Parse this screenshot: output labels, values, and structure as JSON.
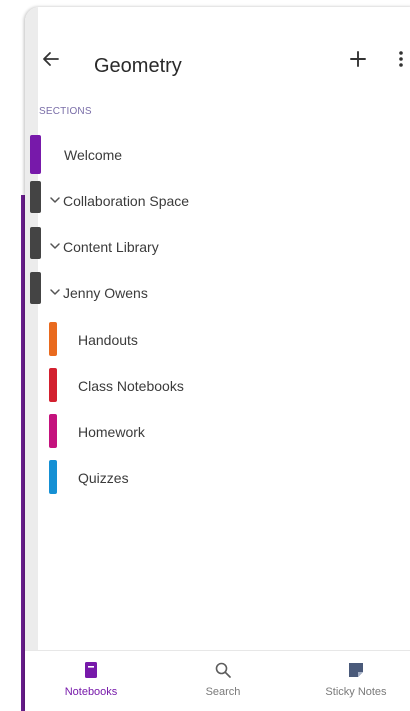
{
  "header": {
    "title": "Geometry",
    "icons": {
      "back": "arrow-left-icon",
      "add": "plus-icon",
      "more": "more-vertical-icon"
    }
  },
  "sections_label": "SECTIONS",
  "sections": [
    {
      "label": "Welcome",
      "type": "section",
      "color": "#7719aa"
    },
    {
      "label": "Collaboration Space",
      "type": "group",
      "color": "#444444"
    },
    {
      "label": "Content Library",
      "type": "group",
      "color": "#444444"
    },
    {
      "label": "Jenny Owens",
      "type": "group",
      "color": "#444444"
    },
    {
      "label": "Handouts",
      "type": "section",
      "color": "#e96a1e"
    },
    {
      "label": "Class Notebooks",
      "type": "section",
      "color": "#d3202f"
    },
    {
      "label": "Homework",
      "type": "section",
      "color": "#c4127d"
    },
    {
      "label": "Quizzes",
      "type": "section",
      "color": "#1590d4"
    }
  ],
  "bottom_nav": [
    {
      "label": "Notebooks",
      "icon": "notebook-icon",
      "active": true
    },
    {
      "label": "Search",
      "icon": "search-icon",
      "active": false
    },
    {
      "label": "Sticky Notes",
      "icon": "sticky-note-icon",
      "active": false
    }
  ],
  "colors": {
    "accent": "#7719aa",
    "group": "#444444"
  }
}
